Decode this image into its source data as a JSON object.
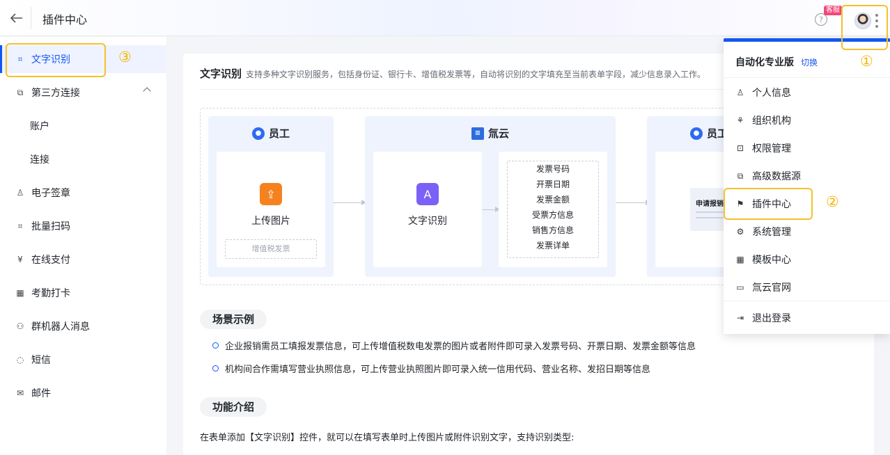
{
  "header": {
    "title": "插件中心",
    "help_icon": "?",
    "kefu_badge": "客服"
  },
  "sidebar": {
    "items": [
      {
        "label": "文字识别",
        "icon": "scan-text-icon",
        "glyph": "⌗",
        "active": true
      },
      {
        "label": "第三方连接",
        "icon": "link-icon",
        "glyph": "⧉",
        "expanded": true
      },
      {
        "label": "账户",
        "sub": true
      },
      {
        "label": "连接",
        "sub": true
      },
      {
        "label": "电子签章",
        "icon": "stamp-icon",
        "glyph": "♙"
      },
      {
        "label": "批量扫码",
        "icon": "scan-icon",
        "glyph": "⌗"
      },
      {
        "label": "在线支付",
        "icon": "yen-icon",
        "glyph": "¥"
      },
      {
        "label": "考勤打卡",
        "icon": "calendar-check-icon",
        "glyph": "▦"
      },
      {
        "label": "群机器人消息",
        "icon": "robot-icon",
        "glyph": "⚇"
      },
      {
        "label": "短信",
        "icon": "message-icon",
        "glyph": "◌"
      },
      {
        "label": "邮件",
        "icon": "mail-icon",
        "glyph": "✉"
      }
    ]
  },
  "main": {
    "title": "文字识别",
    "desc": "支持多种文字识别服务，包括身份证、银行卡、增值税发票等，自动将识别的文字填充至当前表单字段，减少信息录入工作。",
    "flow": {
      "panel1": {
        "title": "员工",
        "action": "上传图片",
        "tag": "增值税发票"
      },
      "panel2": {
        "title": "氚云",
        "action": "文字识别",
        "fields": [
          "发票号码",
          "开票日期",
          "发票金额",
          "受票方信息",
          "销售方信息",
          "发票详单"
        ]
      },
      "panel3": {
        "title": "员工",
        "form_label": "申请报销"
      }
    },
    "scene_title": "场景示例",
    "scenes": [
      "企业报销需员工填报发票信息，可上传增值税数电发票的图片或者附件即可录入发票号码、开票日期、发票金额等信息",
      "机构间合作需填写营业执照信息，可上传营业执照图片即可录入统一信用代码、营业名称、发招日期等信息"
    ],
    "feature_title": "功能介绍",
    "feature_intro": "在表单添加【文字识别】控件，就可以在填写表单时上传图片或附件识别文字，支持识别类型:"
  },
  "dropdown": {
    "plan": "自动化专业版",
    "switch": "切换",
    "items": [
      {
        "label": "个人信息",
        "icon": "user-icon",
        "glyph": "♙"
      },
      {
        "label": "组织机构",
        "icon": "org-chart-icon",
        "glyph": "⚘"
      },
      {
        "label": "权限管理",
        "icon": "lock-icon",
        "glyph": "⊡"
      },
      {
        "label": "高级数据源",
        "icon": "copy-icon",
        "glyph": "⧉"
      },
      {
        "label": "插件中心",
        "icon": "flag-icon",
        "glyph": "⚑"
      },
      {
        "label": "系统管理",
        "icon": "gear-icon",
        "glyph": "⚙"
      },
      {
        "label": "模板中心",
        "icon": "grid-icon",
        "glyph": "▦"
      },
      {
        "label": "氚云官网",
        "icon": "browser-icon",
        "glyph": "▭"
      },
      {
        "label": "退出登录",
        "icon": "logout-icon",
        "glyph": "⇥"
      }
    ]
  },
  "annotations": [
    "①",
    "②",
    "③"
  ],
  "colors": {
    "accent": "#1456f0",
    "highlight": "#f4c02c",
    "badge": "#f2477a"
  }
}
